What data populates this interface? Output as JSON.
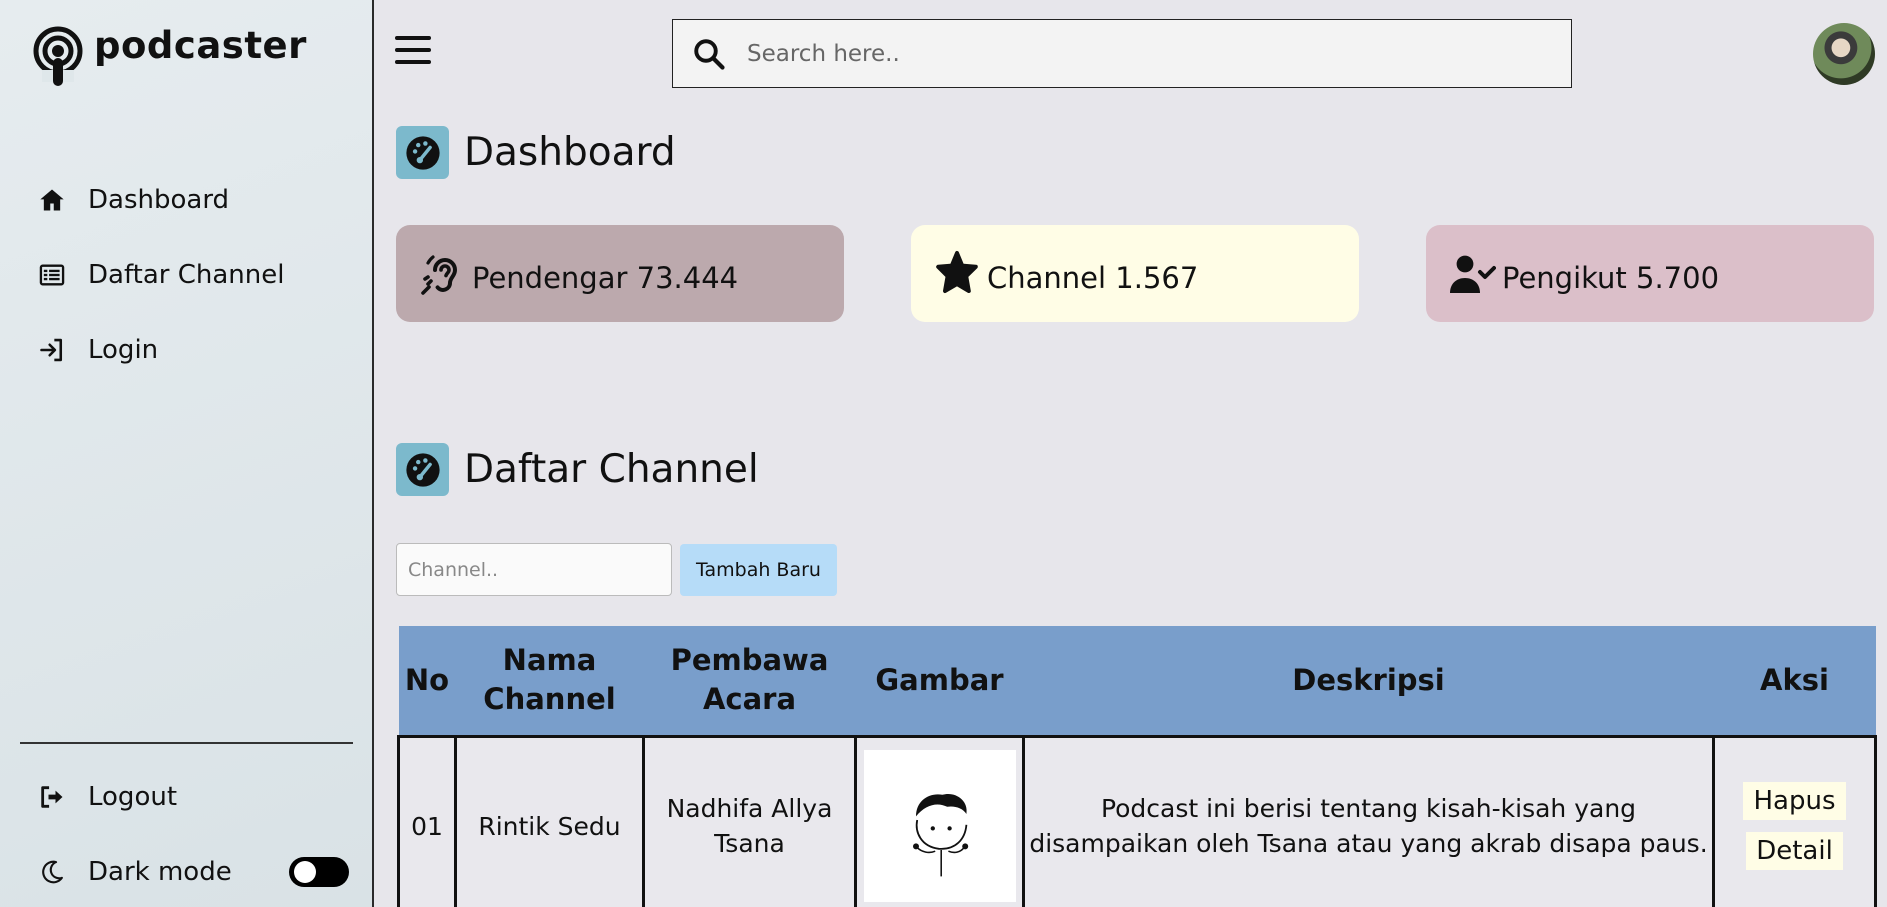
{
  "brand": {
    "name": "podcaster",
    "icon": "podcast-icon"
  },
  "sidebar": {
    "items": [
      {
        "label": "Dashboard",
        "icon": "home-icon"
      },
      {
        "label": "Daftar Channel",
        "icon": "list-icon"
      },
      {
        "label": "Login",
        "icon": "login-icon"
      }
    ],
    "bottom": {
      "logout": {
        "label": "Logout",
        "icon": "logout-icon"
      },
      "darkmode": {
        "label": "Dark mode",
        "icon": "moon-icon",
        "enabled": false
      }
    }
  },
  "header": {
    "search_placeholder": "Search here.."
  },
  "dashboard": {
    "title": "Dashboard",
    "stats": [
      {
        "label": "Pendengar 73.444",
        "icon": "ear-icon",
        "color": "#bca9ad"
      },
      {
        "label": "Channel 1.567",
        "icon": "star-icon",
        "color": "#fffde6"
      },
      {
        "label": "Pengikut 5.700",
        "icon": "user-check-icon",
        "color": "#dbbfc9"
      }
    ]
  },
  "channels": {
    "title": "Daftar Channel",
    "input_placeholder": "Channel..",
    "add_label": "Tambah Baru",
    "columns": [
      "No",
      "Nama Channel",
      "Pembawa Acara",
      "Gambar",
      "Deskripsi",
      "Aksi"
    ],
    "rows": [
      {
        "no": "01",
        "name": "Rintik Sedu",
        "host": "Nadhifa Allya Tsana",
        "description": "Podcast ini berisi tentang kisah-kisah yang disampaikan oleh Tsana atau yang akrab disapa paus.",
        "delete_label": "Hapus",
        "detail_label": "Detail"
      }
    ]
  },
  "colors": {
    "accent_badge": "#7cb9cc",
    "table_header": "#799ecb",
    "add_button": "#b6dcf8"
  }
}
